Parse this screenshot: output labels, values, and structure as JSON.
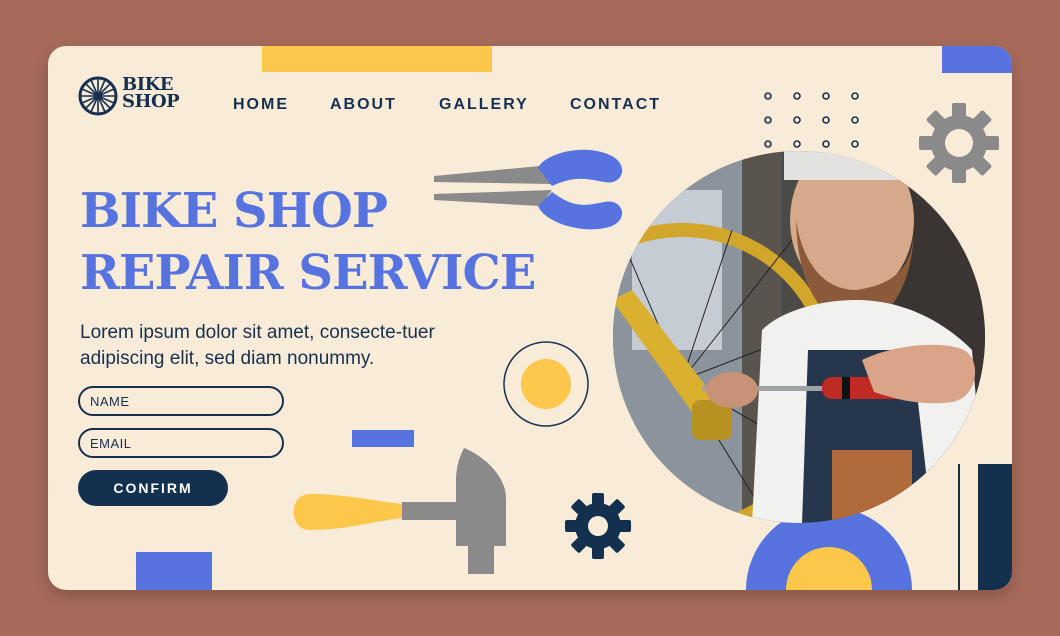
{
  "brand": {
    "name_line1": "BIKE",
    "name_line2": "SHOP"
  },
  "nav": {
    "home": "HOME",
    "about": "ABOUT",
    "gallery": "GALLERY",
    "contact": "CONTACT"
  },
  "hero": {
    "title_line1": "BIKE SHOP",
    "title_line2": "REPAIR SERVICE",
    "description": "Lorem ipsum dolor sit amet, consecte-tuer adipiscing elit, sed diam nonummy."
  },
  "form": {
    "name_placeholder": "NAME",
    "email_placeholder": "EMAIL",
    "confirm_label": "CONFIRM"
  },
  "colors": {
    "background": "#a66a5a",
    "card": "#f8ecd9",
    "navy": "#13304e",
    "blue": "#5673e0",
    "yellow": "#fcc74a",
    "gray": "#8a8a8a"
  },
  "icons": [
    "bicycle-wheel-logo-icon",
    "pliers-icon",
    "gear-icon",
    "hammer-icon"
  ]
}
